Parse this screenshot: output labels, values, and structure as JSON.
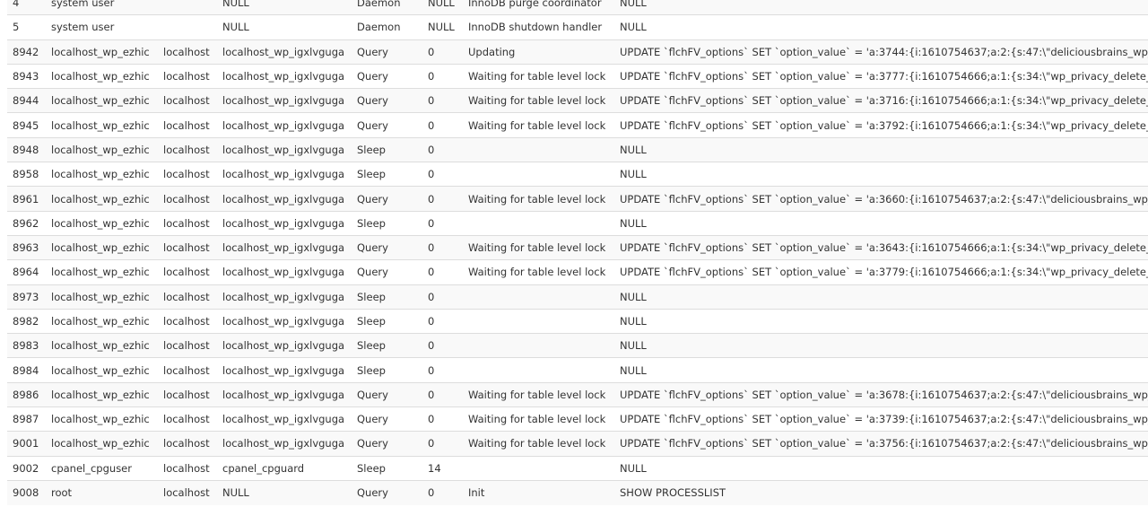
{
  "processlist": {
    "rows": [
      {
        "id": "4",
        "user": "system user",
        "host": "",
        "db": "NULL",
        "command": "Daemon",
        "time": "NULL",
        "state": "InnoDB purge coordinator",
        "info": "NULL"
      },
      {
        "id": "5",
        "user": "system user",
        "host": "",
        "db": "NULL",
        "command": "Daemon",
        "time": "NULL",
        "state": "InnoDB shutdown handler",
        "info": "NULL"
      },
      {
        "id": "8942",
        "user": "localhost_wp_ezhic",
        "host": "localhost",
        "db": "localhost_wp_igxlvguga",
        "command": "Query",
        "time": "0",
        "state": "Updating",
        "info": "UPDATE `flchFV_options` SET `option_value` = 'a:3744:{i:1610754637;a:2:{s:47:\\\"deliciousbrains_wp_of"
      },
      {
        "id": "8943",
        "user": "localhost_wp_ezhic",
        "host": "localhost",
        "db": "localhost_wp_igxlvguga",
        "command": "Query",
        "time": "0",
        "state": "Waiting for table level lock",
        "info": "UPDATE `flchFV_options` SET `option_value` = 'a:3777:{i:1610754666;a:1:{s:34:\\\"wp_privacy_delete_old"
      },
      {
        "id": "8944",
        "user": "localhost_wp_ezhic",
        "host": "localhost",
        "db": "localhost_wp_igxlvguga",
        "command": "Query",
        "time": "0",
        "state": "Waiting for table level lock",
        "info": "UPDATE `flchFV_options` SET `option_value` = 'a:3716:{i:1610754666;a:1:{s:34:\\\"wp_privacy_delete_old"
      },
      {
        "id": "8945",
        "user": "localhost_wp_ezhic",
        "host": "localhost",
        "db": "localhost_wp_igxlvguga",
        "command": "Query",
        "time": "0",
        "state": "Waiting for table level lock",
        "info": "UPDATE `flchFV_options` SET `option_value` = 'a:3792:{i:1610754666;a:1:{s:34:\\\"wp_privacy_delete_old"
      },
      {
        "id": "8948",
        "user": "localhost_wp_ezhic",
        "host": "localhost",
        "db": "localhost_wp_igxlvguga",
        "command": "Sleep",
        "time": "0",
        "state": "",
        "info": "NULL"
      },
      {
        "id": "8958",
        "user": "localhost_wp_ezhic",
        "host": "localhost",
        "db": "localhost_wp_igxlvguga",
        "command": "Sleep",
        "time": "0",
        "state": "",
        "info": "NULL"
      },
      {
        "id": "8961",
        "user": "localhost_wp_ezhic",
        "host": "localhost",
        "db": "localhost_wp_igxlvguga",
        "command": "Query",
        "time": "0",
        "state": "Waiting for table level lock",
        "info": "UPDATE `flchFV_options` SET `option_value` = 'a:3660:{i:1610754637;a:2:{s:47:\\\"deliciousbrains_wp_of"
      },
      {
        "id": "8962",
        "user": "localhost_wp_ezhic",
        "host": "localhost",
        "db": "localhost_wp_igxlvguga",
        "command": "Sleep",
        "time": "0",
        "state": "",
        "info": "NULL"
      },
      {
        "id": "8963",
        "user": "localhost_wp_ezhic",
        "host": "localhost",
        "db": "localhost_wp_igxlvguga",
        "command": "Query",
        "time": "0",
        "state": "Waiting for table level lock",
        "info": "UPDATE `flchFV_options` SET `option_value` = 'a:3643:{i:1610754666;a:1:{s:34:\\\"wp_privacy_delete_old"
      },
      {
        "id": "8964",
        "user": "localhost_wp_ezhic",
        "host": "localhost",
        "db": "localhost_wp_igxlvguga",
        "command": "Query",
        "time": "0",
        "state": "Waiting for table level lock",
        "info": "UPDATE `flchFV_options` SET `option_value` = 'a:3779:{i:1610754666;a:1:{s:34:\\\"wp_privacy_delete_old"
      },
      {
        "id": "8973",
        "user": "localhost_wp_ezhic",
        "host": "localhost",
        "db": "localhost_wp_igxlvguga",
        "command": "Sleep",
        "time": "0",
        "state": "",
        "info": "NULL"
      },
      {
        "id": "8982",
        "user": "localhost_wp_ezhic",
        "host": "localhost",
        "db": "localhost_wp_igxlvguga",
        "command": "Sleep",
        "time": "0",
        "state": "",
        "info": "NULL"
      },
      {
        "id": "8983",
        "user": "localhost_wp_ezhic",
        "host": "localhost",
        "db": "localhost_wp_igxlvguga",
        "command": "Sleep",
        "time": "0",
        "state": "",
        "info": "NULL"
      },
      {
        "id": "8984",
        "user": "localhost_wp_ezhic",
        "host": "localhost",
        "db": "localhost_wp_igxlvguga",
        "command": "Sleep",
        "time": "0",
        "state": "",
        "info": "NULL"
      },
      {
        "id": "8986",
        "user": "localhost_wp_ezhic",
        "host": "localhost",
        "db": "localhost_wp_igxlvguga",
        "command": "Query",
        "time": "0",
        "state": "Waiting for table level lock",
        "info": "UPDATE `flchFV_options` SET `option_value` = 'a:3678:{i:1610754637;a:2:{s:47:\\\"deliciousbrains_wp_of"
      },
      {
        "id": "8987",
        "user": "localhost_wp_ezhic",
        "host": "localhost",
        "db": "localhost_wp_igxlvguga",
        "command": "Query",
        "time": "0",
        "state": "Waiting for table level lock",
        "info": "UPDATE `flchFV_options` SET `option_value` = 'a:3739:{i:1610754637;a:2:{s:47:\\\"deliciousbrains_wp_of"
      },
      {
        "id": "9001",
        "user": "localhost_wp_ezhic",
        "host": "localhost",
        "db": "localhost_wp_igxlvguga",
        "command": "Query",
        "time": "0",
        "state": "Waiting for table level lock",
        "info": "UPDATE `flchFV_options` SET `option_value` = 'a:3756:{i:1610754637;a:2:{s:47:\\\"deliciousbrains_wp_of"
      },
      {
        "id": "9002",
        "user": "cpanel_cpguser",
        "host": "localhost",
        "db": "cpanel_cpguard",
        "command": "Sleep",
        "time": "14",
        "state": "",
        "info": "NULL"
      },
      {
        "id": "9008",
        "user": "root",
        "host": "localhost",
        "db": "NULL",
        "command": "Query",
        "time": "0",
        "state": "Init",
        "info": "SHOW PROCESSLIST"
      }
    ]
  }
}
